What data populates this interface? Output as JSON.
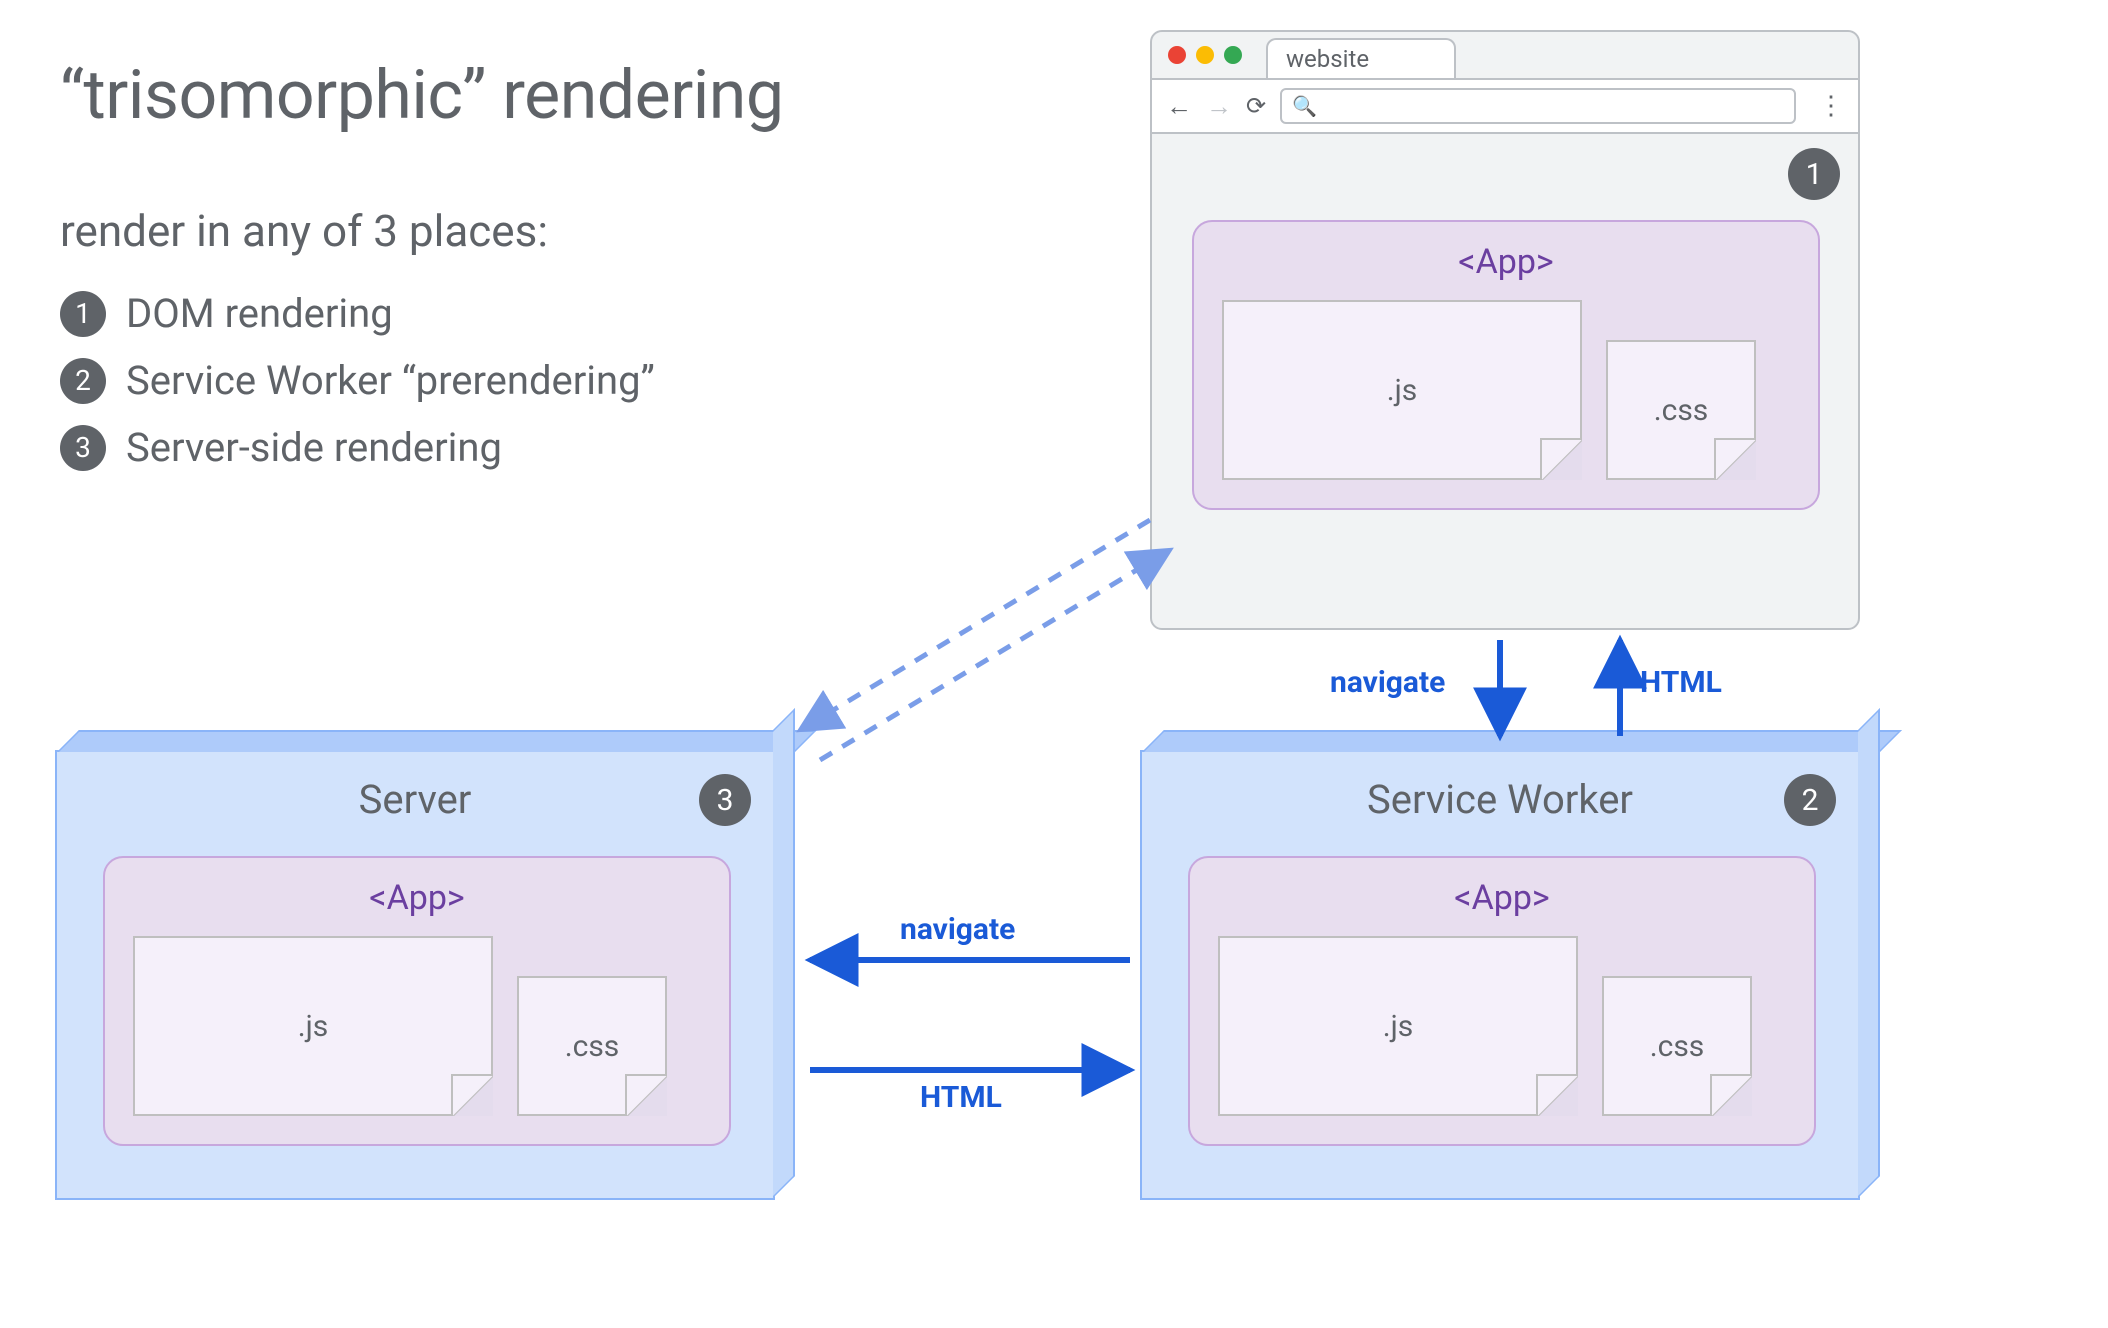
{
  "title": "“trisomorphic” rendering",
  "subtitle": "render in any of 3 places:",
  "list": [
    {
      "num": "1",
      "label": "DOM rendering"
    },
    {
      "num": "2",
      "label": "Service Worker “prerendering”"
    },
    {
      "num": "3",
      "label": "Server-side rendering"
    }
  ],
  "browser": {
    "tab_label": "website",
    "badge": "1",
    "app_label": "<App>",
    "files": {
      "js": ".js",
      "css": ".css"
    }
  },
  "service_worker": {
    "title": "Service Worker",
    "badge": "2",
    "app_label": "<App>",
    "files": {
      "js": ".js",
      "css": ".css"
    }
  },
  "server": {
    "title": "Server",
    "badge": "3",
    "app_label": "<App>",
    "files": {
      "js": ".js",
      "css": ".css"
    }
  },
  "flows": {
    "browser_to_sw": "navigate",
    "sw_to_browser": "HTML",
    "sw_to_server": "navigate",
    "server_to_sw": "HTML"
  },
  "colors": {
    "text": "#5f6368",
    "badge": "#5f6368",
    "arrow": "#1a5ad7",
    "box_fill": "#d2e3fc",
    "box_stroke": "#8ab4f8",
    "app_fill": "#e8deef",
    "app_stroke": "#c7a7dd",
    "app_text": "#6b3fa0"
  }
}
